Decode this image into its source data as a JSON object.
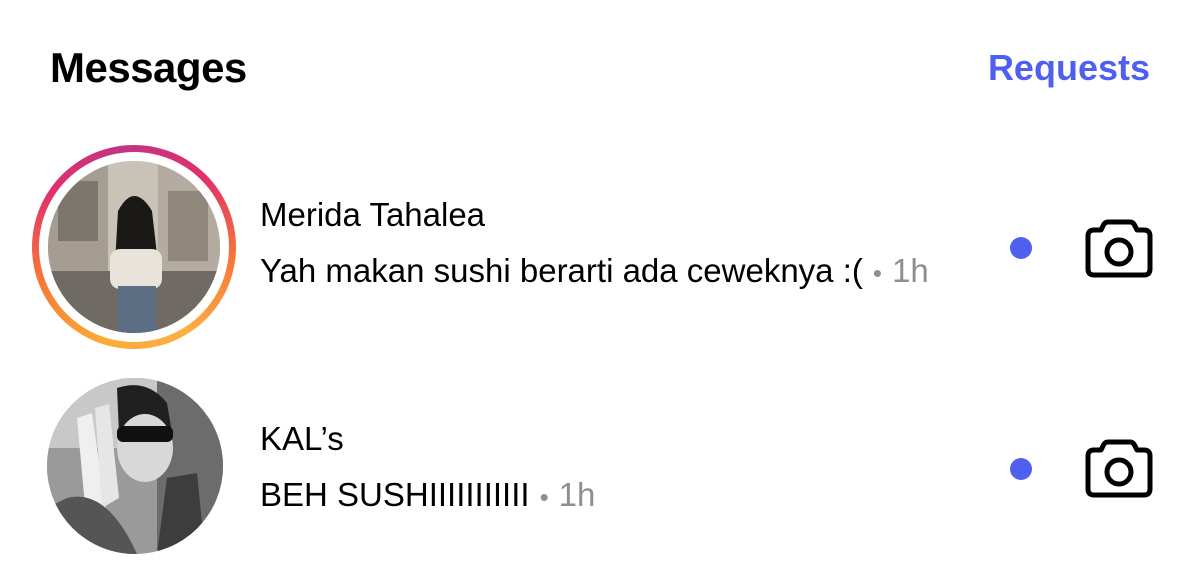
{
  "header": {
    "title": "Messages",
    "requests_label": "Requests"
  },
  "colors": {
    "accent": "#4f5ff0",
    "unread_dot": "#4f5ff0",
    "secondary_text": "#8e8e8e"
  },
  "threads": [
    {
      "name": "Merida Tahalea",
      "preview": "Yah makan sushi berarti ada ceweknya :(",
      "separator": "•",
      "time": "1h",
      "has_story_ring": true,
      "unread": true,
      "action_icon": "camera-icon"
    },
    {
      "name": "KAL’s",
      "preview": "BEH SUSHIIIIIIIIIII",
      "separator": "•",
      "time": "1h",
      "has_story_ring": false,
      "unread": true,
      "action_icon": "camera-icon"
    }
  ]
}
